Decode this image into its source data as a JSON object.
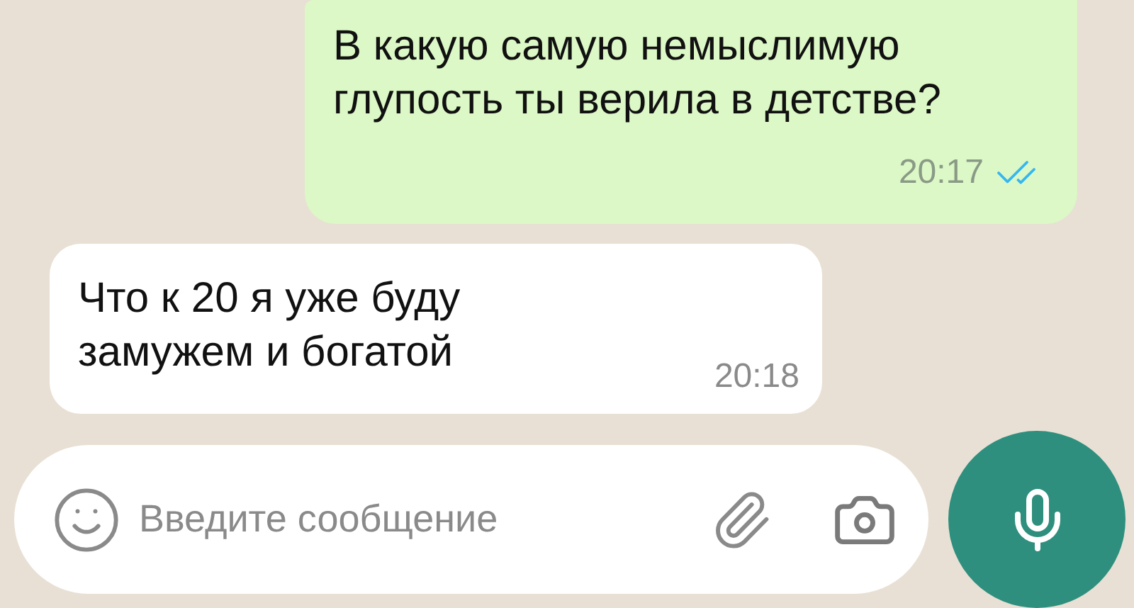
{
  "messages": [
    {
      "kind": "outgoing",
      "lines": [
        "В какую самую немыслимую",
        "глупость ты верила в детстве?"
      ],
      "time": "20:17",
      "read": true
    },
    {
      "kind": "incoming",
      "lines": [
        "Что к 20 я уже буду",
        "замужем и богатой"
      ],
      "time": "20:18"
    }
  ],
  "composer": {
    "placeholder": "Введите сообщение"
  }
}
